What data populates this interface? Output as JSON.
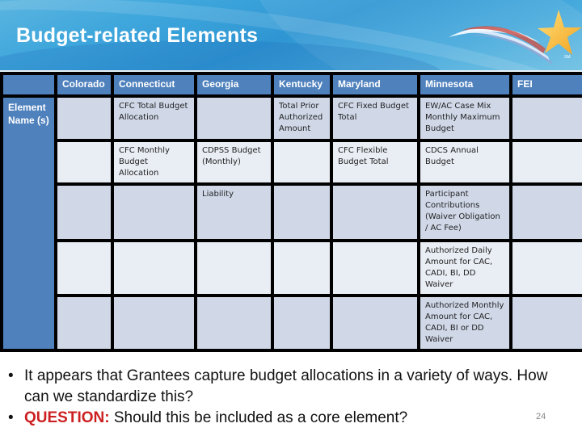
{
  "slide": {
    "title": "Budget-related Elements",
    "page_number": "24",
    "logo": {
      "icon": "shooting-star-logo",
      "trademark": "SM"
    }
  },
  "table": {
    "corner": "",
    "row_header": "Element Name (s)",
    "columns": [
      "Colorado",
      "Connecticut",
      "Georgia",
      "Kentucky",
      "Maryland",
      "Minnesota",
      "FEI"
    ],
    "rows": [
      [
        "",
        "CFC Total Budget Allocation",
        "",
        "Total Prior Authorized Amount",
        "CFC Fixed Budget Total",
        "EW/AC Case Mix Monthly Maximum Budget",
        ""
      ],
      [
        "",
        "CFC Monthly Budget Allocation",
        "CDPSS Budget (Monthly)",
        "",
        "CFC Flexible Budget Total",
        "CDCS Annual Budget",
        ""
      ],
      [
        "",
        "",
        "Liability",
        "",
        "",
        "Participant Contributions (Waiver Obligation / AC Fee)",
        ""
      ],
      [
        "",
        "",
        "",
        "",
        "",
        "Authorized Daily Amount for CAC, CADI, BI, DD Waiver",
        ""
      ],
      [
        "",
        "",
        "",
        "",
        "",
        "Authorized Monthly Amount for CAC, CADI, BI or DD Waiver",
        ""
      ]
    ]
  },
  "bullets": [
    {
      "prefix": "",
      "text": "It appears that Grantees capture budget allocations in a variety of ways. How can we standardize this?"
    },
    {
      "prefix": "QUESTION:",
      "text": " Should this be included as a core element?"
    }
  ],
  "colors": {
    "header_blue": "#4f81bd",
    "row_odd": "#d0d8e8",
    "row_even": "#e9edf4",
    "question_red": "#cc1f1f"
  }
}
